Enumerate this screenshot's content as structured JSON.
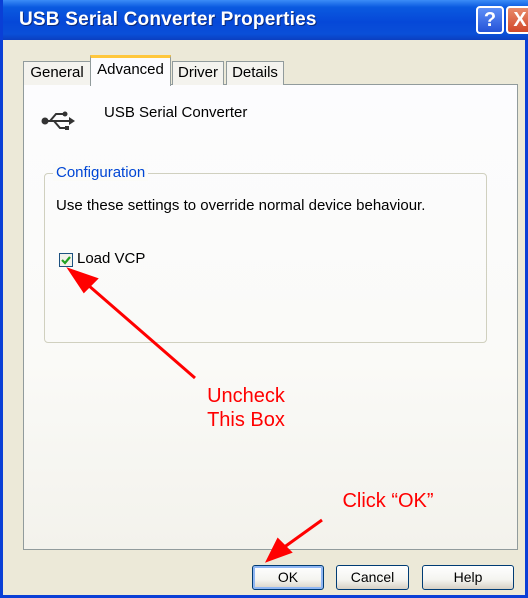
{
  "window": {
    "title": "USB Serial Converter Properties",
    "help_button_glyph": "?",
    "close_button_glyph": "X"
  },
  "tabs": [
    {
      "label": "General",
      "active": false
    },
    {
      "label": "Advanced",
      "active": true
    },
    {
      "label": "Driver",
      "active": false
    },
    {
      "label": "Details",
      "active": false
    }
  ],
  "device": {
    "icon": "usb-icon",
    "name": "USB Serial Converter"
  },
  "configuration": {
    "legend": "Configuration",
    "description": "Use these settings to override normal device behaviour.",
    "load_vcp": {
      "label": "Load VCP",
      "checked": true
    }
  },
  "buttons": {
    "ok": "OK",
    "cancel": "Cancel",
    "help": "Help"
  },
  "annotations": {
    "uncheck_line1": "Uncheck",
    "uncheck_line2": "This Box",
    "click_ok": "Click “OK”",
    "color": "#ff0000"
  },
  "colors": {
    "titlebar": "#0a4fd8",
    "legend_text": "#0046d5",
    "tab_highlight": "#ffc73c"
  }
}
